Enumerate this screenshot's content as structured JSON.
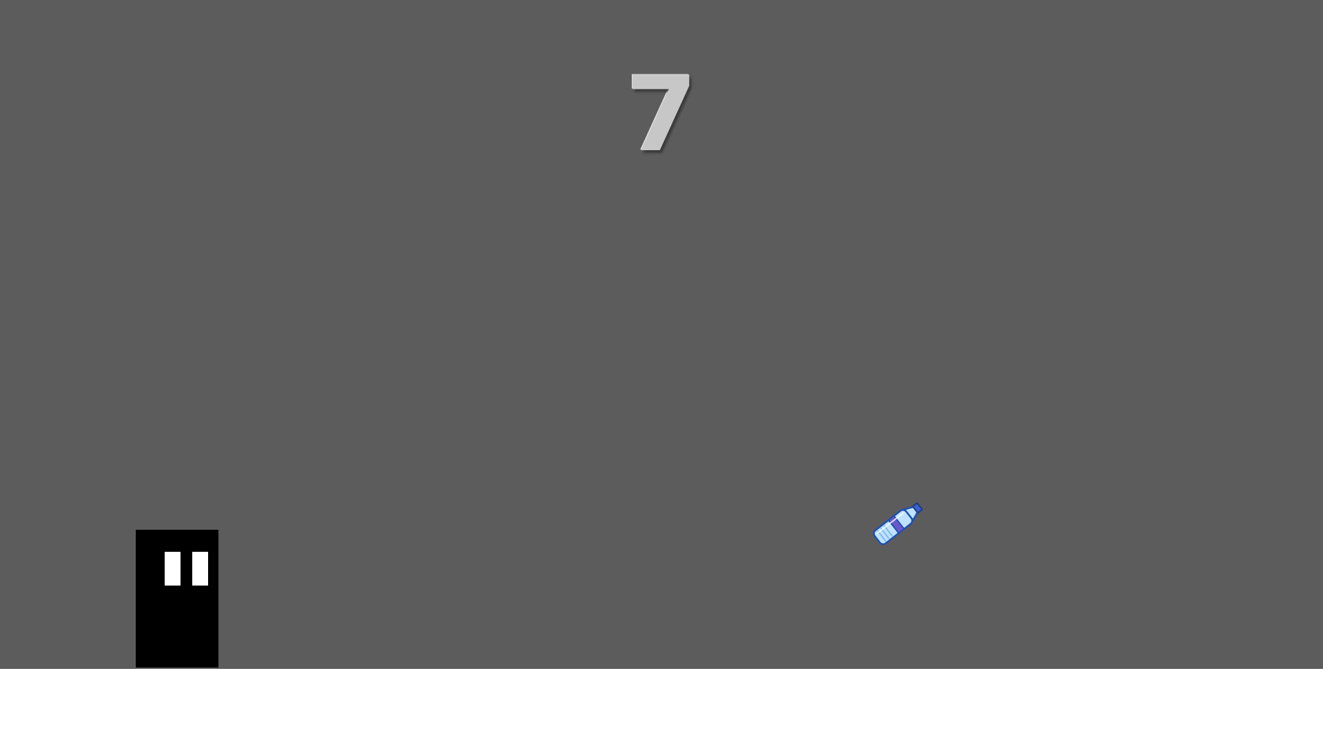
{
  "game": {
    "score": "7",
    "background_color": "#5c5c5c",
    "floor_color": "#ffffff",
    "table_color": "#000000"
  },
  "controls": {
    "pause_icon": "pause-icon"
  },
  "sprites": {
    "bottle_icon": "water-bottle-icon",
    "bottle_cap_color": "#3b62c9",
    "bottle_label_color": "#6a58c9",
    "bottle_body_color": "#bfe3ff"
  }
}
